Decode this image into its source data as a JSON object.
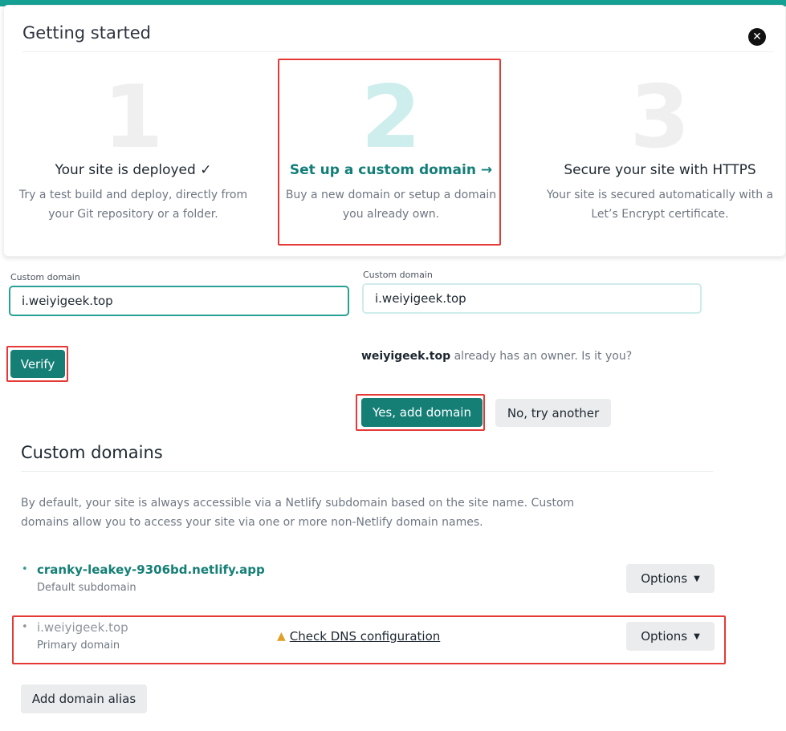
{
  "getting_started": {
    "title": "Getting started",
    "close_icon": "close-icon",
    "steps": [
      {
        "number": "1",
        "heading": "Your site is deployed ✓",
        "desc_line1": "Try a test build and deploy, directly from",
        "desc_line2": "your Git repository or a folder."
      },
      {
        "number": "2",
        "heading": "Set up a custom domain →",
        "desc_line1": "Buy a new domain or setup a domain",
        "desc_line2": "you already own."
      },
      {
        "number": "3",
        "heading": "Secure your site with HTTPS",
        "desc_line1": "Your site is secured automatically with a",
        "desc_line2": "Let’s Encrypt certificate."
      }
    ]
  },
  "form_left": {
    "label": "Custom domain",
    "value": "i.weiyigeek.top",
    "verify_label": "Verify"
  },
  "form_right": {
    "label": "Custom domain",
    "value": "i.weiyigeek.top",
    "owner_domain": "weiyigeek.top",
    "owner_question": " already has an owner. Is it you?",
    "yes_label": "Yes, add domain",
    "no_label": "No, try another"
  },
  "custom_domains": {
    "title": "Custom domains",
    "desc_line1": "By default, your site is always accessible via a Netlify subdomain based on the site name. Custom",
    "desc_line2": "domains allow you to access your site via one or more non-Netlify domain names.",
    "domains": [
      {
        "name": "cranky-leakey-9306bd.netlify.app",
        "sub": "Default subdomain",
        "options_label": "Options"
      },
      {
        "name": "i.weiyigeek.top",
        "sub": "Primary domain",
        "options_label": "Options",
        "warning": "Check DNS configuration"
      }
    ],
    "add_alias_label": "Add domain alias"
  },
  "colors": {
    "accent": "#14a093",
    "button_teal": "#157f76",
    "highlight_red": "#e53935",
    "warning": "#e0a028"
  }
}
